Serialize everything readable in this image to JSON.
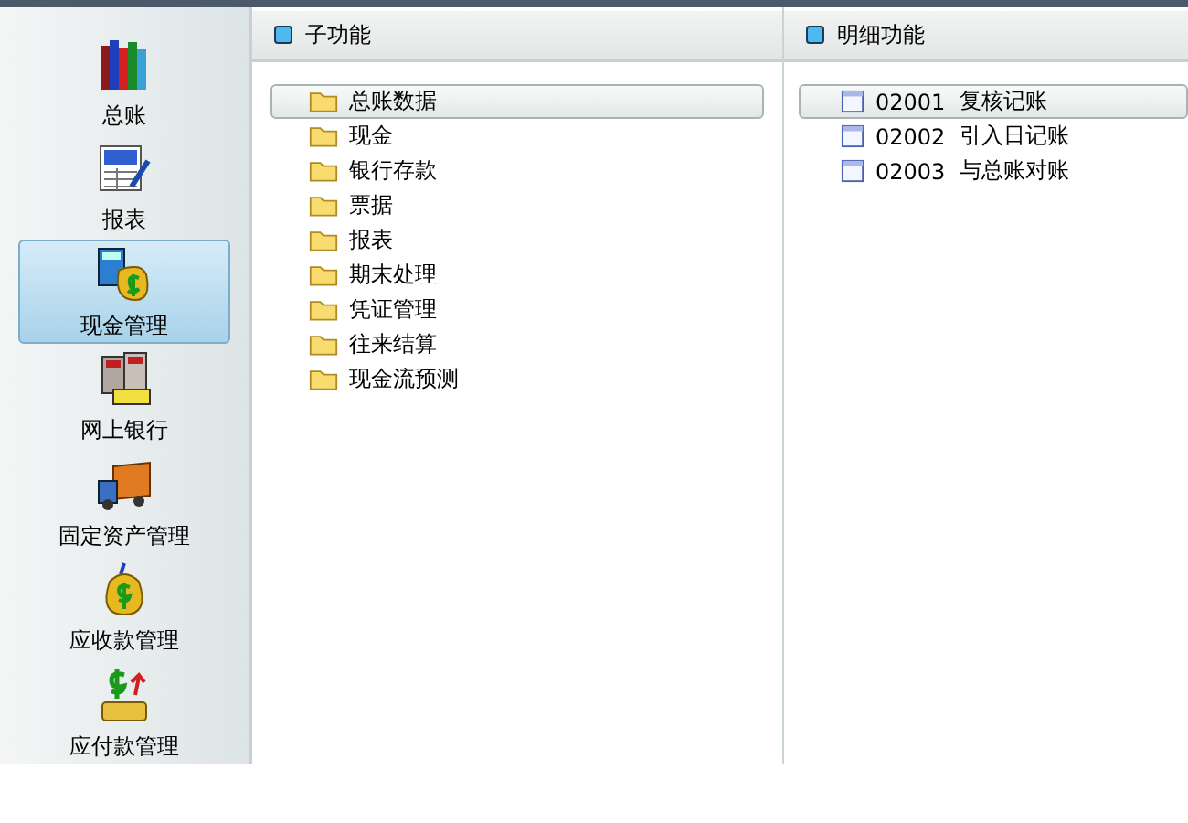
{
  "sidebar": {
    "items": [
      {
        "label": "总账",
        "kind": "books",
        "selected": false
      },
      {
        "label": "报表",
        "kind": "report",
        "selected": false
      },
      {
        "label": "现金管理",
        "kind": "cash",
        "selected": true
      },
      {
        "label": "网上银行",
        "kind": "bank",
        "selected": false
      },
      {
        "label": "固定资产管理",
        "kind": "truck",
        "selected": false
      },
      {
        "label": "应收款管理",
        "kind": "moneybag",
        "selected": false
      },
      {
        "label": "应付款管理",
        "kind": "payment",
        "selected": false
      }
    ]
  },
  "sub_functions": {
    "title": "子功能",
    "items": [
      {
        "label": "总账数据",
        "selected": true
      },
      {
        "label": "现金",
        "selected": false
      },
      {
        "label": "银行存款",
        "selected": false
      },
      {
        "label": "票据",
        "selected": false
      },
      {
        "label": "报表",
        "selected": false
      },
      {
        "label": "期末处理",
        "selected": false
      },
      {
        "label": "凭证管理",
        "selected": false
      },
      {
        "label": "往来结算",
        "selected": false
      },
      {
        "label": "现金流预测",
        "selected": false
      }
    ]
  },
  "detail_functions": {
    "title": "明细功能",
    "items": [
      {
        "code": "02001",
        "label": "复核记账",
        "selected": true
      },
      {
        "code": "02002",
        "label": "引入日记账",
        "selected": false
      },
      {
        "code": "02003",
        "label": "与总账对账",
        "selected": false
      }
    ]
  }
}
